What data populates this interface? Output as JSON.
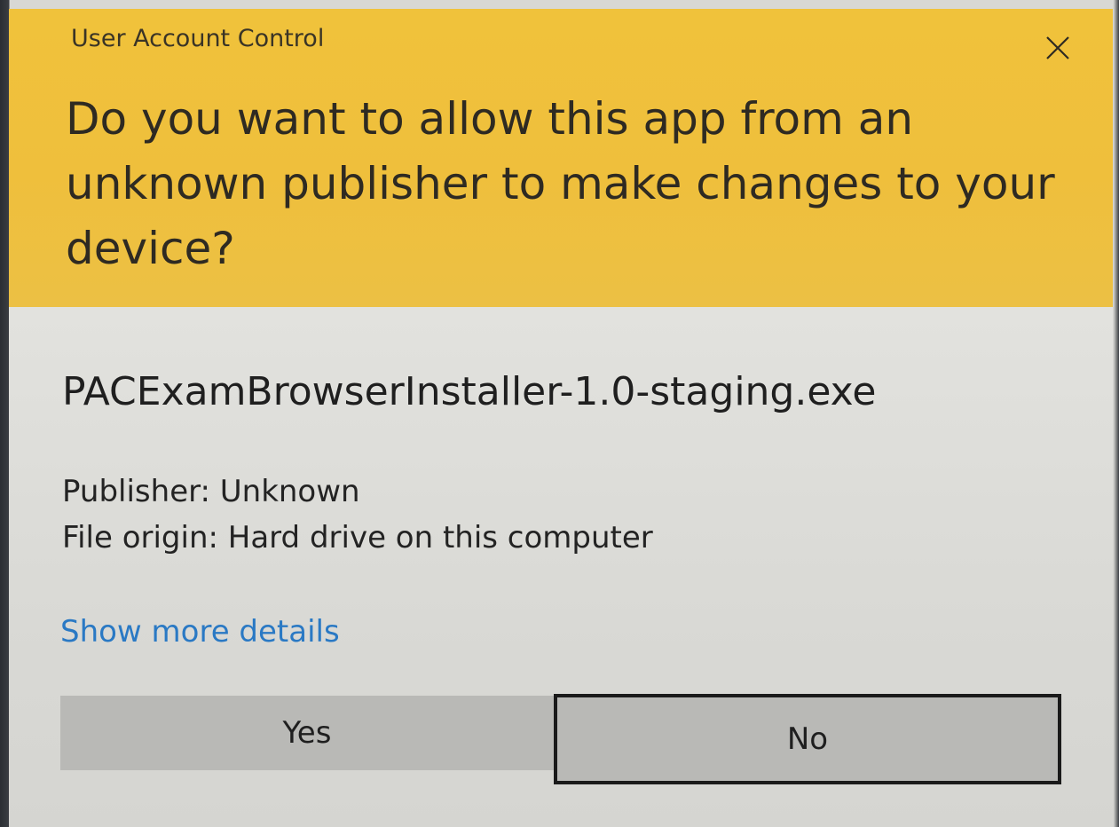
{
  "window": {
    "title": "User Account Control"
  },
  "header": {
    "question": "Do you want to allow this app from an unknown publisher to make changes to your device?"
  },
  "app": {
    "name": "PACExamBrowserInstaller-1.0-staging.exe",
    "publisher": "Publisher: Unknown",
    "file_origin": "File origin: Hard drive on this computer",
    "details_link": "Show more details"
  },
  "buttons": {
    "yes_label": "Yes",
    "no_label": "No"
  },
  "icons": {
    "close": "close-icon"
  },
  "colors": {
    "header_bg": "#f0c23b",
    "body_bg": "#dcdcd8",
    "link": "#2a79c4",
    "button_bg": "#b9b9b6"
  }
}
